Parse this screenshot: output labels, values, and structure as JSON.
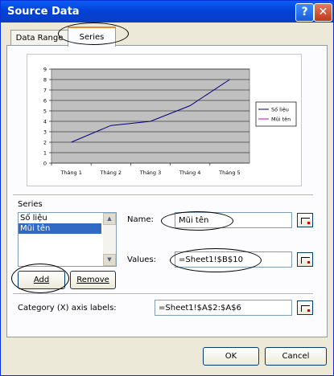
{
  "window": {
    "title": "Source Data",
    "help_glyph": "?",
    "close_glyph": "✕"
  },
  "tabs": [
    {
      "label": "Data Range"
    },
    {
      "label": "Series"
    }
  ],
  "chart_data": {
    "type": "line",
    "categories": [
      "Tháng 1",
      "Tháng 2",
      "Tháng 3",
      "Tháng 4",
      "Tháng 5"
    ],
    "series": [
      {
        "name": "Số liệu",
        "values": [
          2,
          3.6,
          4,
          5.5,
          8
        ],
        "color": "#00007f"
      },
      {
        "name": "Mũi tên",
        "values": [],
        "color": "#cc00cc"
      }
    ],
    "ylim": [
      0,
      9
    ],
    "yticks": [
      "0",
      "1",
      "2",
      "3",
      "4",
      "5",
      "6",
      "7",
      "8",
      "9"
    ],
    "grid": true,
    "plot_background": "#c0c0c0",
    "legend_position": "right"
  },
  "series_section": {
    "label": "Series",
    "items": [
      "Số liệu",
      "Mũi tên"
    ],
    "selected_index": 1,
    "add_label": "Add",
    "remove_label": "Remove"
  },
  "name_field": {
    "label": "Name:",
    "value": "Mũi tên"
  },
  "values_field": {
    "label": "Values:",
    "value": "=Sheet1!$B$10"
  },
  "category_field": {
    "label": "Category (X) axis labels:",
    "value": "=Sheet1!$A$2:$A$6"
  },
  "footer": {
    "ok_label": "OK",
    "cancel_label": "Cancel"
  }
}
